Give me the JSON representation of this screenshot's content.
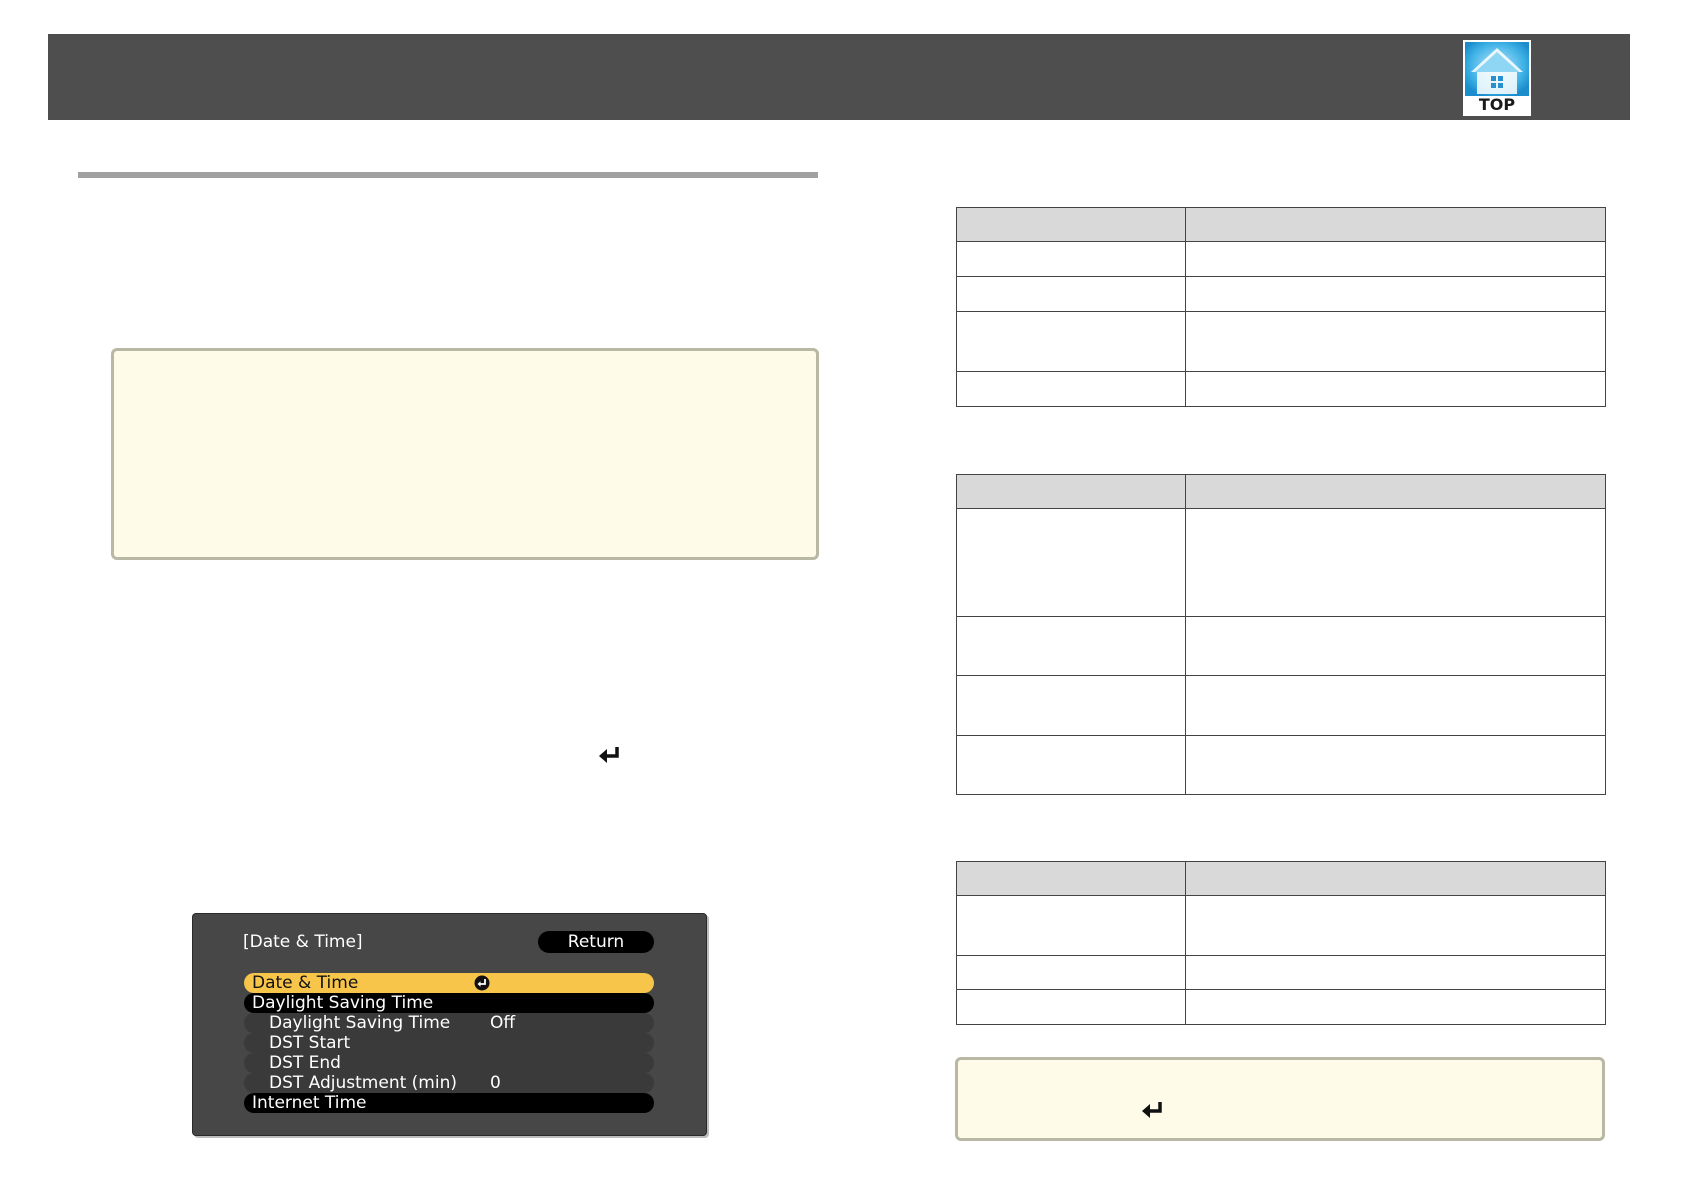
{
  "header": {
    "top_logo_text": "TOP"
  },
  "osd_menu": {
    "title": "[Date & Time]",
    "return_label": "Return",
    "items": [
      {
        "label": "Date & Time",
        "value": "",
        "state": "selected",
        "icon": "enter-icon"
      },
      {
        "label": "Daylight Saving Time",
        "value": "",
        "state": "group"
      },
      {
        "label": "Daylight Saving Time",
        "value": "Off",
        "state": "sub"
      },
      {
        "label": "DST Start",
        "value": "",
        "state": "sub"
      },
      {
        "label": "DST End",
        "value": "",
        "state": "sub"
      },
      {
        "label": "DST Adjustment (min)",
        "value": "0",
        "state": "sub"
      },
      {
        "label": "Internet Time",
        "value": "",
        "state": "group"
      }
    ]
  },
  "icons": {
    "enter_icon": "enter-arrow-icon",
    "top_logo": "house-icon"
  },
  "colors": {
    "header_bar": "#4e4e4e",
    "note_background": "#fefbe9",
    "osd_selected": "#f7c54a",
    "table_header": "#d9d9d9"
  }
}
